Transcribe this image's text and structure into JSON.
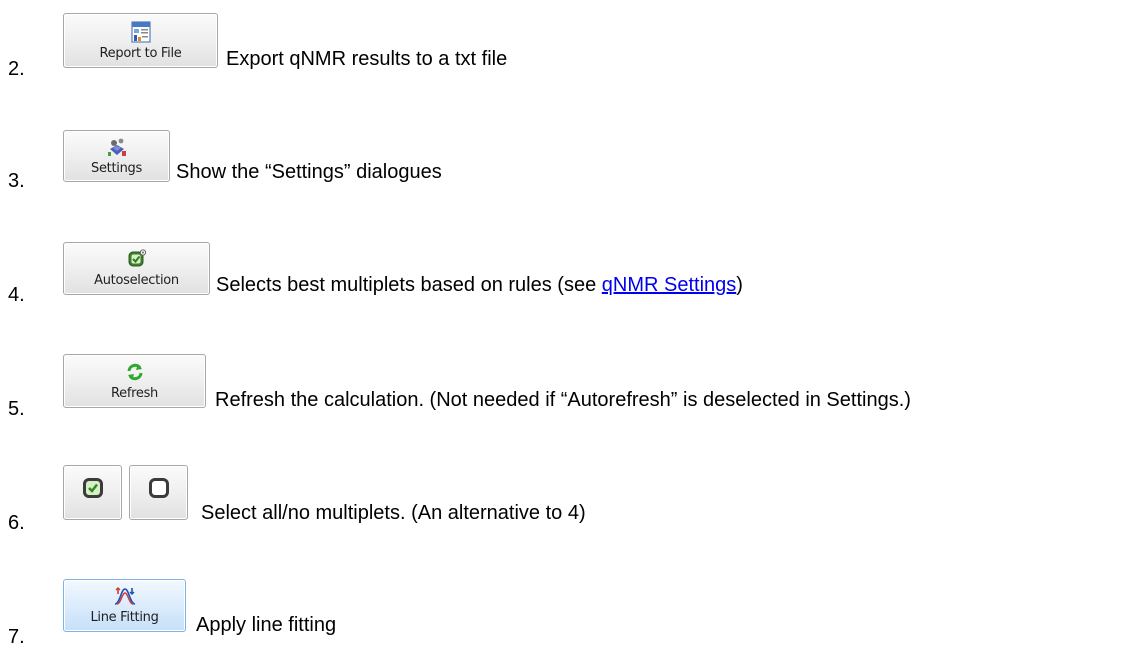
{
  "items": [
    {
      "number": "2.",
      "button_label": "Report to File",
      "icon": "report-file-icon",
      "description": "Export qNMR results to a txt file"
    },
    {
      "number": "3.",
      "button_label": "Settings",
      "icon": "settings-icon",
      "description": "Show the “Settings” dialogues"
    },
    {
      "number": "4.",
      "button_label": "Autoselection",
      "icon": "autoselection-icon",
      "description_before": "Selects best multiplets based on rules (see ",
      "link_text": "qNMR Settings",
      "description_after": ")"
    },
    {
      "number": "5.",
      "button_label": "Refresh",
      "icon": "refresh-icon",
      "description": "Refresh the calculation. (Not needed if “Autorefresh” is deselected in Settings.)"
    },
    {
      "number": "6.",
      "icons": [
        "select-all-icon",
        "select-none-icon"
      ],
      "description": "Select all/no multiplets. (An alternative to 4)"
    },
    {
      "number": "7.",
      "button_label": "Line Fitting",
      "icon": "line-fitting-icon",
      "description": "Apply line fitting"
    }
  ],
  "colors": {
    "link": "#0000ee",
    "button_border": "#a7a7a7",
    "line_fitting_border": "#7eb4ea"
  }
}
